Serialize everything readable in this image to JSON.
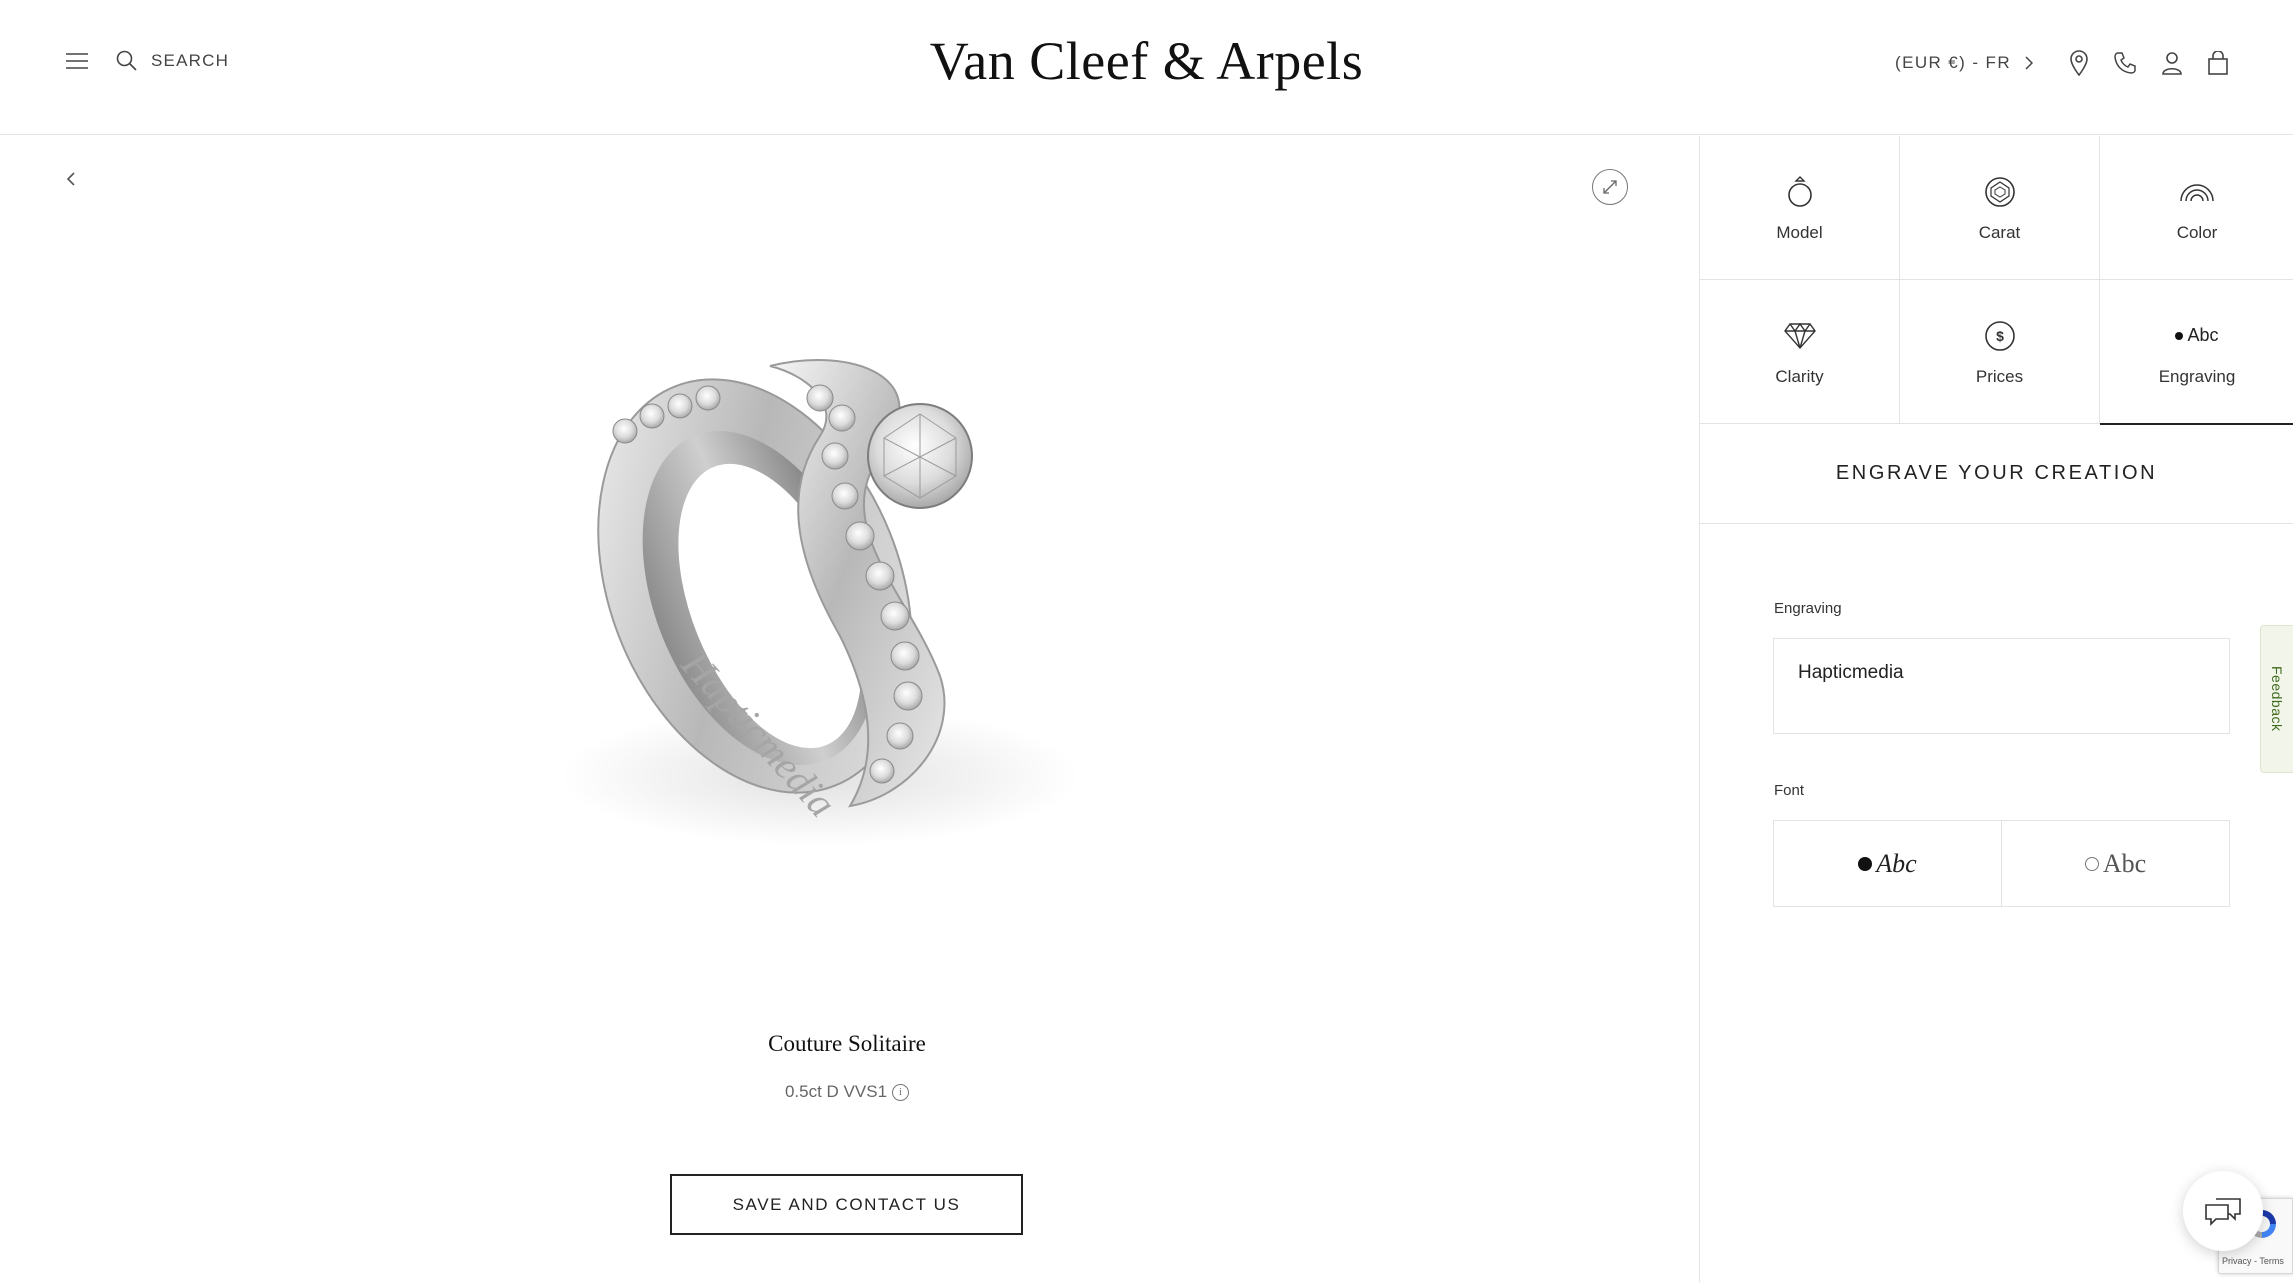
{
  "header": {
    "search_label": "SEARCH",
    "brand": "Van Cleef & Arpels",
    "locale": "(EUR €) - FR"
  },
  "product": {
    "name": "Couture Solitaire",
    "spec": "0.5ct D VVS1",
    "engraved_text": "Hapticmedia",
    "cta_label": "SAVE AND CONTACT US"
  },
  "panel": {
    "options": [
      {
        "label": "Model",
        "icon": "ring-icon"
      },
      {
        "label": "Carat",
        "icon": "diamond-top-icon"
      },
      {
        "label": "Color",
        "icon": "rainbow-icon"
      },
      {
        "label": "Clarity",
        "icon": "diamond-icon"
      },
      {
        "label": "Prices",
        "icon": "dollar-icon"
      },
      {
        "label": "Engraving",
        "icon": "abc-icon",
        "icon_text": "Abc",
        "active": true
      }
    ],
    "section_title": "ENGRAVE YOUR CREATION",
    "engraving_label": "Engraving",
    "engraving_value": "Hapticmedia",
    "font_label": "Font",
    "font_options": [
      {
        "sample": "Abc",
        "style": "script",
        "selected": true
      },
      {
        "sample": "Abc",
        "style": "serif",
        "selected": false
      }
    ]
  },
  "widgets": {
    "feedback_label": "Feedback",
    "recaptcha_text": "Privacy - Terms"
  },
  "colors": {
    "text": "#1a1a1a",
    "border": "#e3e3e3",
    "feedback_bg": "#f2f6ea",
    "feedback_text": "#3f6a1e"
  }
}
